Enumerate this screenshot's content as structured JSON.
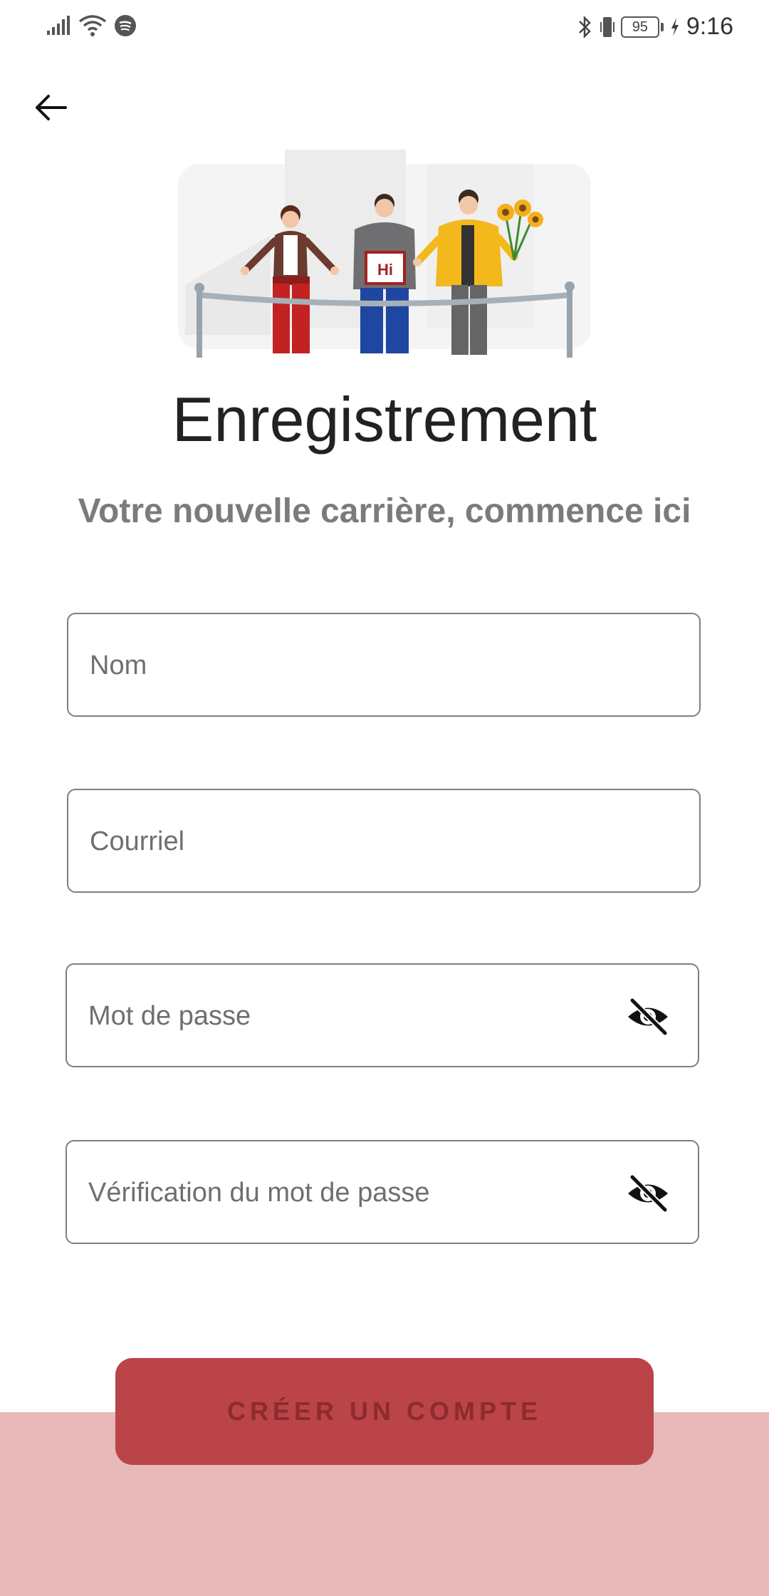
{
  "status_bar": {
    "time": "9:16",
    "battery_level": "95"
  },
  "header": {
    "back_icon": "arrow-left-icon"
  },
  "hero": {
    "sign_text": "Hi"
  },
  "page": {
    "title": "Enregistrement",
    "subtitle": "Votre nouvelle carrière, commence ici"
  },
  "form": {
    "name_placeholder": "Nom",
    "email_placeholder": "Courriel",
    "password_placeholder": "Mot de passe",
    "confirm_password_placeholder": "Vérification du mot de passe",
    "visibility_icon": "eye-off-icon"
  },
  "actions": {
    "create_account_label": "CRÉER UN COMPTE"
  },
  "colors": {
    "accent": "#ba4448",
    "accent_text": "#8c2b2e",
    "band": "#e8b9b9"
  }
}
